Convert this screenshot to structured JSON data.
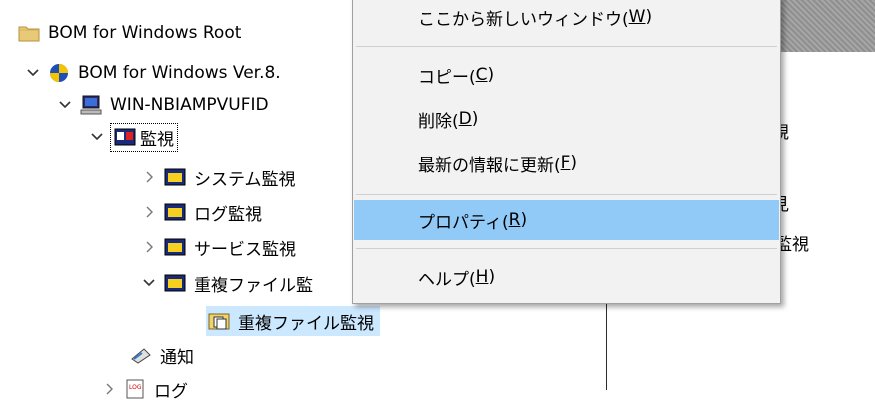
{
  "tree": {
    "items": [
      {
        "label": "BOM for Windows Root",
        "icon": "folder-icon"
      },
      {
        "label": "BOM for Windows Ver.8.",
        "icon": "bom-globe-icon"
      },
      {
        "label": "WIN-NBIAMPVUFID",
        "icon": "computer-icon"
      },
      {
        "label": "監視",
        "icon": "monitor-group-icon"
      },
      {
        "label": "システム監視",
        "icon": "monitor-folder-icon"
      },
      {
        "label": "ログ監視",
        "icon": "monitor-folder-icon"
      },
      {
        "label": "サービス監視",
        "icon": "monitor-folder-icon"
      },
      {
        "label": "重複ファイル監",
        "icon": "monitor-folder-icon"
      },
      {
        "label": "重複ファイル監視",
        "icon": "duplicate-file-icon"
      },
      {
        "label": "通知",
        "icon": "notify-icon"
      },
      {
        "label": "ログ",
        "icon": "log-icon"
      }
    ]
  },
  "right_panel": {
    "frag1": "視",
    "frag2": "見",
    "frag3": "監視"
  },
  "context_menu": {
    "items": [
      {
        "text": "ここから新しいウィンドウ(",
        "key": "W",
        "close": ")"
      },
      {
        "text": "コピー(",
        "key": "C",
        "close": ")"
      },
      {
        "text": "削除(",
        "key": "D",
        "close": ")"
      },
      {
        "text": "最新の情報に更新(",
        "key": "F",
        "close": ")"
      },
      {
        "text": "プロパティ(",
        "key": "R",
        "close": ")"
      },
      {
        "text": "ヘルプ(",
        "key": "H",
        "close": ")"
      }
    ],
    "highlighted_index": 4
  },
  "colors": {
    "menu_bg": "#f2f2f2",
    "menu_highlight": "#91c9f7",
    "tree_selected_bg": "#cce8ff"
  }
}
